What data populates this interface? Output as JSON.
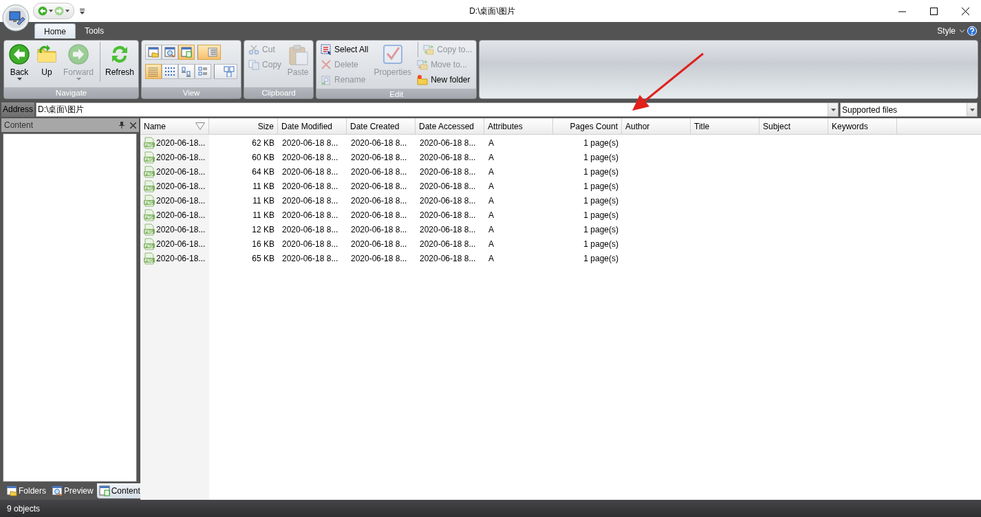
{
  "window": {
    "title": "D:\\桌面\\图片"
  },
  "ribbon": {
    "tabs": [
      {
        "label": "Home",
        "selected": true
      },
      {
        "label": "Tools",
        "selected": false
      }
    ],
    "style_menu": "Style",
    "groups": [
      {
        "label": "Navigate",
        "kind": "buttons",
        "columns": [
          [
            {
              "label": "Back",
              "kind": "large",
              "disabled": false,
              "dropdown": true,
              "separator_before": false
            }
          ],
          [
            {
              "label": "Up",
              "kind": "large",
              "disabled": false,
              "dropdown": false,
              "separator_before": false
            }
          ],
          [
            {
              "label": "Forward",
              "kind": "large",
              "disabled": true,
              "dropdown": true,
              "separator_before": false
            }
          ],
          [
            {
              "label": "Refresh",
              "kind": "large",
              "disabled": false,
              "dropdown": false,
              "separator_before": true
            }
          ]
        ]
      },
      {
        "label": "View",
        "kind": "view",
        "rows": [
          [
            {
              "selected": false,
              "separator_before": false
            },
            {
              "selected": false,
              "separator_before": false
            },
            {
              "selected": true,
              "separator_before": false
            },
            {
              "selected": true,
              "separator_before": true
            }
          ],
          [
            {
              "selected": true,
              "separator_before": false
            },
            {
              "selected": false,
              "separator_before": false
            },
            {
              "selected": false,
              "separator_before": false
            },
            {
              "selected": false,
              "separator_before": false
            },
            {
              "selected": false,
              "separator_before": true
            }
          ]
        ]
      },
      {
        "label": "Clipboard",
        "kind": "buttons",
        "columns": [
          [
            {
              "label": "Cut",
              "kind": "small",
              "disabled": true,
              "dropdown": false,
              "separator_before": false
            },
            {
              "label": "Copy",
              "kind": "small",
              "disabled": true,
              "dropdown": false,
              "separator_before": false
            }
          ],
          [
            {
              "label": "Paste",
              "kind": "large",
              "disabled": true,
              "dropdown": false,
              "separator_before": false
            }
          ]
        ]
      },
      {
        "label": "Edit",
        "kind": "buttons",
        "columns": [
          [
            {
              "label": "Select All",
              "kind": "small",
              "disabled": false,
              "dropdown": false,
              "separator_before": false
            },
            {
              "label": "Delete",
              "kind": "small",
              "disabled": true,
              "dropdown": false,
              "separator_before": false
            },
            {
              "label": "Rename",
              "kind": "small",
              "disabled": true,
              "dropdown": false,
              "separator_before": false
            }
          ],
          [
            {
              "label": "Properties",
              "kind": "large",
              "disabled": true,
              "dropdown": false,
              "separator_before": false
            }
          ],
          [
            {
              "label": "Copy to...",
              "kind": "small",
              "disabled": true,
              "dropdown": false,
              "separator_before": true
            },
            {
              "label": "Move to...",
              "kind": "small",
              "disabled": true,
              "dropdown": false,
              "separator_before": false
            },
            {
              "label": "New folder",
              "kind": "small",
              "disabled": false,
              "dropdown": false,
              "separator_before": false
            }
          ]
        ]
      }
    ]
  },
  "address_bar": {
    "label": "Address",
    "value": "D:\\桌面\\图片",
    "filter": "Supported files"
  },
  "side_panel": {
    "title": "Content",
    "tabs": [
      {
        "label": "Folders",
        "selected": false
      },
      {
        "label": "Preview",
        "selected": false
      },
      {
        "label": "Content",
        "selected": true
      }
    ]
  },
  "table": {
    "columns": [
      {
        "label": "Name",
        "sorted": true
      },
      {
        "label": "Size",
        "sorted": false
      },
      {
        "label": "Date Modified",
        "sorted": false
      },
      {
        "label": "Date Created",
        "sorted": false
      },
      {
        "label": "Date Accessed",
        "sorted": false
      },
      {
        "label": "Attributes",
        "sorted": false
      },
      {
        "label": "Pages Count",
        "sorted": false
      },
      {
        "label": "Author",
        "sorted": false
      },
      {
        "label": "Title",
        "sorted": false
      },
      {
        "label": "Subject",
        "sorted": false
      },
      {
        "label": "Keywords",
        "sorted": false
      }
    ],
    "rows": [
      [
        "2020-06-18...",
        "62 KB",
        "2020-06-18 8...",
        "2020-06-18 8...",
        "2020-06-18 8...",
        "A",
        "1 page(s)"
      ],
      [
        "2020-06-18...",
        "60 KB",
        "2020-06-18 8...",
        "2020-06-18 8...",
        "2020-06-18 8...",
        "A",
        "1 page(s)"
      ],
      [
        "2020-06-18...",
        "64 KB",
        "2020-06-18 8...",
        "2020-06-18 8...",
        "2020-06-18 8...",
        "A",
        "1 page(s)"
      ],
      [
        "2020-06-18...",
        "11 KB",
        "2020-06-18 8...",
        "2020-06-18 8...",
        "2020-06-18 8...",
        "A",
        "1 page(s)"
      ],
      [
        "2020-06-18...",
        "11 KB",
        "2020-06-18 8...",
        "2020-06-18 8...",
        "2020-06-18 8...",
        "A",
        "1 page(s)"
      ],
      [
        "2020-06-18...",
        "11 KB",
        "2020-06-18 8...",
        "2020-06-18 8...",
        "2020-06-18 8...",
        "A",
        "1 page(s)"
      ],
      [
        "2020-06-18...",
        "12 KB",
        "2020-06-18 8...",
        "2020-06-18 8...",
        "2020-06-18 8...",
        "A",
        "1 page(s)"
      ],
      [
        "2020-06-18...",
        "16 KB",
        "2020-06-18 8...",
        "2020-06-18 8...",
        "2020-06-18 8...",
        "A",
        "1 page(s)"
      ],
      [
        "2020-06-18...",
        "65 KB",
        "2020-06-18 8...",
        "2020-06-18 8...",
        "2020-06-18 8...",
        "A",
        "1 page(s)"
      ]
    ]
  },
  "status_bar": {
    "text": "9 objects"
  }
}
